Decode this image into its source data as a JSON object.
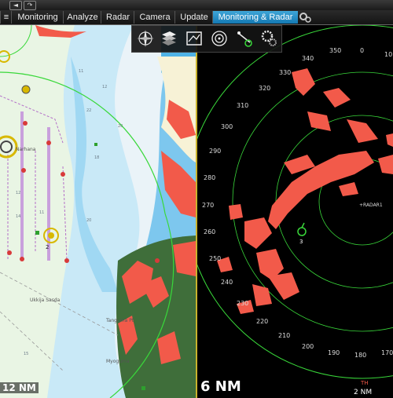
{
  "window": {
    "back_label": "◄",
    "forward_label": "↷"
  },
  "tabs": [
    {
      "label": "Monitoring",
      "active": false
    },
    {
      "label": "Analyze",
      "active": false
    },
    {
      "label": "Radar",
      "active": false
    },
    {
      "label": "Camera",
      "active": false
    },
    {
      "label": "Update",
      "active": false
    },
    {
      "label": "Monitoring & Radar",
      "active": true
    }
  ],
  "toolbar": {
    "tools": [
      "compass-icon",
      "layers-icon",
      "chart-settings-icon",
      "radar-target-icon",
      "track-icon",
      "settings-gear-icon"
    ]
  },
  "chart": {
    "place_names": [
      "Narhana",
      "Ukkija Sasda",
      "Tanguma Pt",
      "Myoguma"
    ],
    "waypoint_label": "2",
    "scale_label": "12 NM",
    "depth_numbers": [
      "11",
      "12",
      "22",
      "20",
      "18",
      "12",
      "14",
      "11",
      "20",
      "15"
    ]
  },
  "radar": {
    "bearings": [
      "350",
      "0",
      "10",
      "340",
      "330",
      "320",
      "310",
      "300",
      "290",
      "280",
      "270",
      "260",
      "250",
      "240",
      "230",
      "220",
      "210",
      "200",
      "190",
      "180",
      "170"
    ],
    "target_label": "RADAR1",
    "target_number": "3",
    "range_label": "6 NM",
    "orientation_label": "TH",
    "range_small_label": "2 NM"
  },
  "colors": {
    "land": "#f25a4a",
    "radar_green": "#39d83a",
    "sea_light": "#bfe6f7",
    "sea_deep": "#6fc6ee",
    "active_tab": "#1e8cc8"
  }
}
